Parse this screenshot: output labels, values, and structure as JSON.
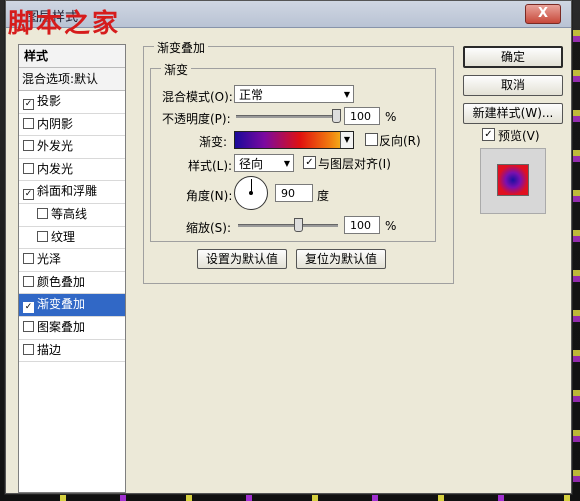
{
  "window": {
    "title": "图层样式",
    "watermark": "脚本之家",
    "close_label": "X"
  },
  "left_panel": {
    "header": "样式",
    "blend_options": "混合选项:默认",
    "items": [
      {
        "label": "投影",
        "checked": true,
        "indent": false,
        "selected": false
      },
      {
        "label": "内阴影",
        "checked": false,
        "indent": false,
        "selected": false
      },
      {
        "label": "外发光",
        "checked": false,
        "indent": false,
        "selected": false
      },
      {
        "label": "内发光",
        "checked": false,
        "indent": false,
        "selected": false
      },
      {
        "label": "斜面和浮雕",
        "checked": true,
        "indent": false,
        "selected": false
      },
      {
        "label": "等高线",
        "checked": false,
        "indent": true,
        "selected": false
      },
      {
        "label": "纹理",
        "checked": false,
        "indent": true,
        "selected": false
      },
      {
        "label": "光泽",
        "checked": false,
        "indent": false,
        "selected": false
      },
      {
        "label": "颜色叠加",
        "checked": false,
        "indent": false,
        "selected": false
      },
      {
        "label": "渐变叠加",
        "checked": true,
        "indent": false,
        "selected": true
      },
      {
        "label": "图案叠加",
        "checked": false,
        "indent": false,
        "selected": false
      },
      {
        "label": "描边",
        "checked": false,
        "indent": false,
        "selected": false
      }
    ]
  },
  "gradient_overlay": {
    "group_title": "渐变叠加",
    "subgroup_title": "渐变",
    "blend_mode_label": "混合模式(O):",
    "blend_mode_value": "正常",
    "opacity_label": "不透明度(P):",
    "opacity_value": "100",
    "opacity_unit": "%",
    "opacity_level": 1.0,
    "gradient_label": "渐变:",
    "reverse_label": "反向(R)",
    "reverse_checked": false,
    "style_label": "样式(L):",
    "style_value": "径向",
    "align_label": "与图层对齐(I)",
    "align_checked": true,
    "angle_label": "角度(N):",
    "angle_value": "90",
    "angle_unit": "度",
    "scale_label": "缩放(S):",
    "scale_value": "100",
    "scale_unit": "%",
    "scale_level": 0.6,
    "set_default_label": "设置为默认值",
    "reset_default_label": "复位为默认值"
  },
  "right_panel": {
    "ok_label": "确定",
    "cancel_label": "取消",
    "new_style_label": "新建样式(W)...",
    "preview_label": "预览(V)",
    "preview_checked": true
  },
  "colors": {
    "selected_bg": "#3168c6",
    "gradient_start": "#1a0a9a",
    "gradient_mid": "#e01010",
    "gradient_end": "#f6e020"
  }
}
